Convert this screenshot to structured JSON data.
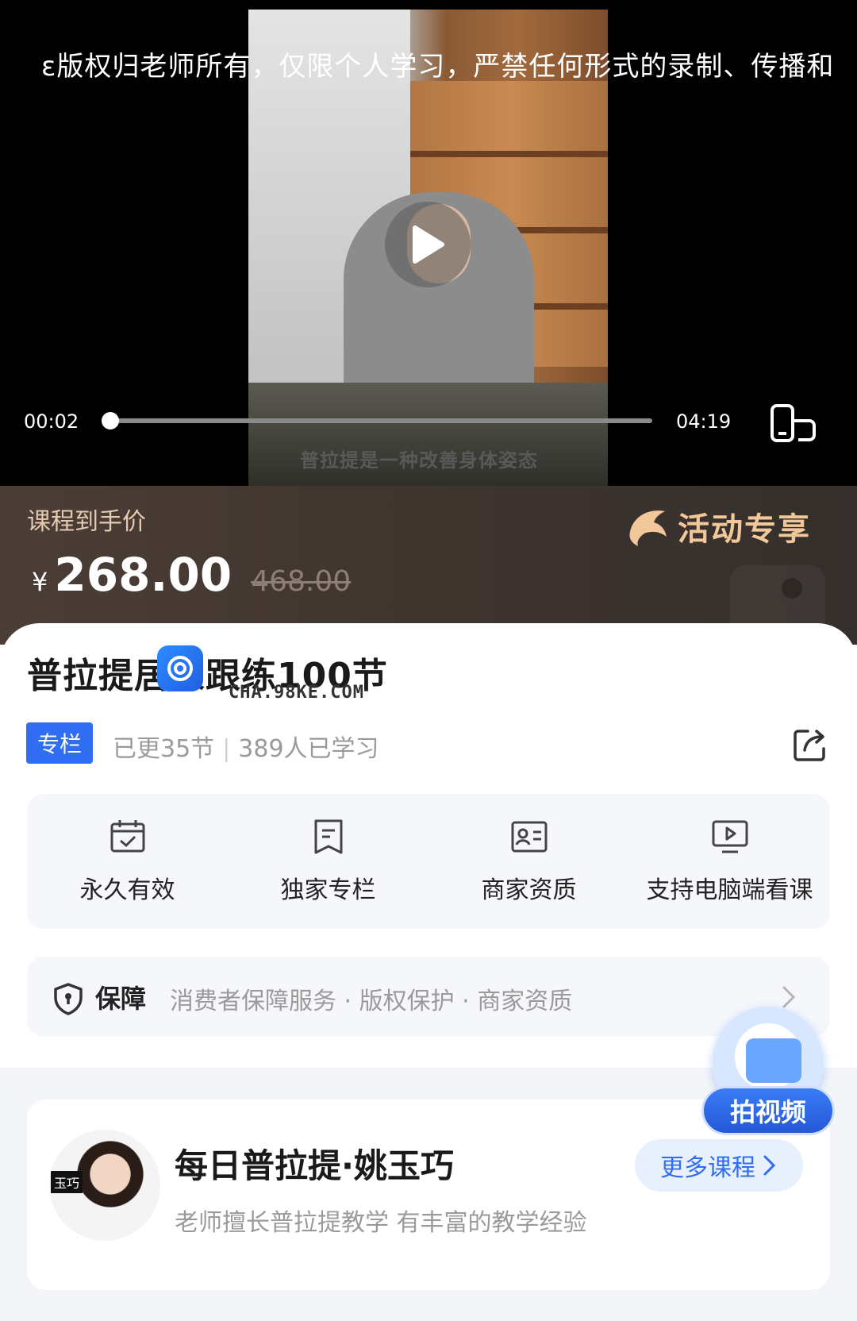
{
  "video": {
    "watermark": "ɛ版权归老师所有，仅限个人学习，严禁任何形式的录制、传播和",
    "subtitle": "普拉提是一种改善身体姿态",
    "current_time": "00:02",
    "total_time": "04:19",
    "progress": 0.01
  },
  "price": {
    "label": "课程到手价",
    "currency": "¥",
    "current": "268.00",
    "original": "468.00",
    "activity_label": "活动专享"
  },
  "course": {
    "title": "普拉提居家跟练100节",
    "watermark_text": "CHA.98KE.COM",
    "badge": "专栏",
    "updated": "已更35节",
    "learners": "389人已学习",
    "features": [
      {
        "icon": "calendar-check-icon",
        "label": "永久有效"
      },
      {
        "icon": "bookmark-doc-icon",
        "label": "独家专栏"
      },
      {
        "icon": "id-card-icon",
        "label": "商家资质"
      },
      {
        "icon": "monitor-play-icon",
        "label": "支持电脑端看课"
      }
    ],
    "guarantee": {
      "title": "保障",
      "text": "消费者保障服务 · 版权保护 · 商家资质"
    }
  },
  "teacher": {
    "name": "每日普拉提·姚玉巧",
    "description": "老师擅长普拉提教学 有丰富的教学经验",
    "more_button": "更多课程",
    "avatar_tag": "玉巧"
  },
  "float_button": {
    "label": "拍视频"
  },
  "colors": {
    "accent": "#2f6ef2",
    "price_banner": "#3f342e",
    "activity_gold": "#f2c79a"
  }
}
